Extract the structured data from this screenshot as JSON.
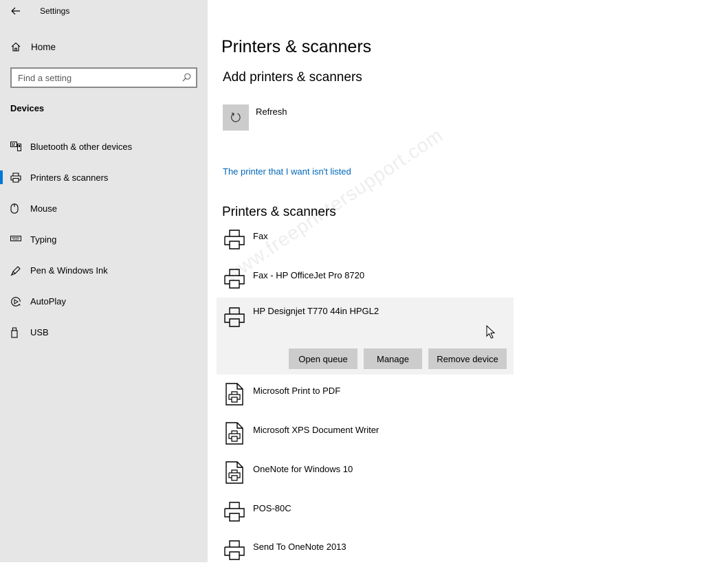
{
  "window": {
    "title": "Settings"
  },
  "sidebar": {
    "home_label": "Home",
    "search_placeholder": "Find a setting",
    "section_heading": "Devices",
    "items": [
      {
        "label": "Bluetooth & other devices",
        "icon": "bluetooth-devices-icon",
        "active": false
      },
      {
        "label": "Printers & scanners",
        "icon": "printer-icon",
        "active": true
      },
      {
        "label": "Mouse",
        "icon": "mouse-icon",
        "active": false
      },
      {
        "label": "Typing",
        "icon": "keyboard-icon",
        "active": false
      },
      {
        "label": "Pen & Windows Ink",
        "icon": "pen-icon",
        "active": false
      },
      {
        "label": "AutoPlay",
        "icon": "autoplay-icon",
        "active": false
      },
      {
        "label": "USB",
        "icon": "usb-icon",
        "active": false
      }
    ]
  },
  "main": {
    "page_title": "Printers & scanners",
    "add_section_title": "Add printers & scanners",
    "refresh_label": "Refresh",
    "not_listed_link": "The printer that I want isn't listed",
    "list_section_title": "Printers & scanners",
    "devices": [
      {
        "name": "Fax",
        "icon": "printer-icon"
      },
      {
        "name": "Fax - HP OfficeJet Pro 8720",
        "icon": "printer-icon"
      },
      {
        "name": "HP Designjet T770 44in HPGL2",
        "icon": "printer-icon",
        "selected": true
      },
      {
        "name": "Microsoft Print to PDF",
        "icon": "document-printer-icon"
      },
      {
        "name": "Microsoft XPS Document Writer",
        "icon": "document-printer-icon"
      },
      {
        "name": "OneNote for Windows 10",
        "icon": "document-printer-icon"
      },
      {
        "name": "POS-80C",
        "icon": "printer-icon"
      },
      {
        "name": "Send To OneNote 2013",
        "icon": "printer-icon"
      }
    ],
    "actions": {
      "open_queue": "Open queue",
      "manage": "Manage",
      "remove_device": "Remove device"
    }
  },
  "watermark": "www.freeprintersupport.com",
  "colors": {
    "accent": "#0078d7",
    "link": "#0067b8",
    "sidebar_bg": "#e6e6e6",
    "button_bg": "#cccccc"
  }
}
